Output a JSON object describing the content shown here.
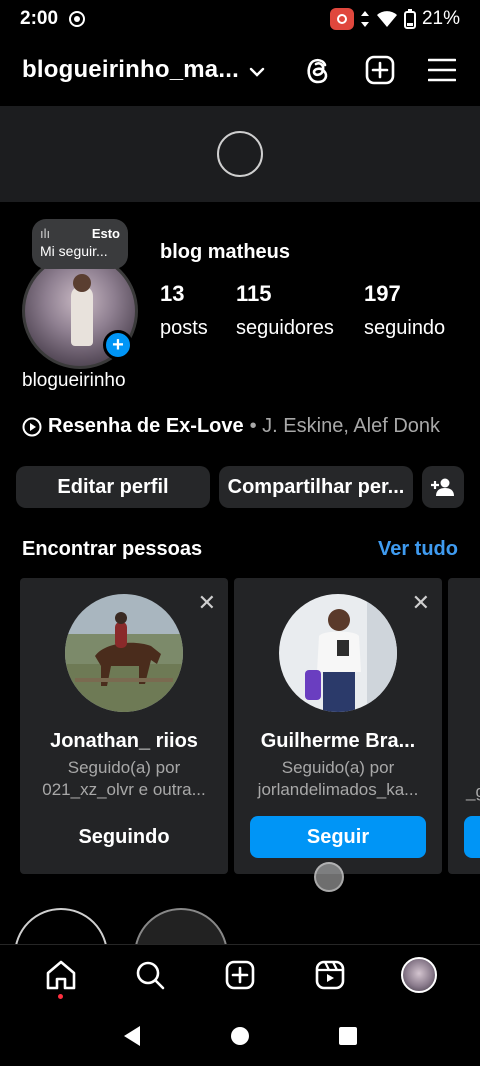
{
  "status": {
    "time": "2:00",
    "battery": "21%"
  },
  "header": {
    "username": "blogueirinho_ma..."
  },
  "profile": {
    "note_prefix": "Esto",
    "note_text": "Mi seguir...",
    "display_name": "blog matheus",
    "handle": "blogueirinho",
    "stats": [
      {
        "num": "13",
        "label": "posts"
      },
      {
        "num": "115",
        "label": "seguidores"
      },
      {
        "num": "197",
        "label": "seguindo"
      }
    ],
    "music_title": "Resenha de Ex-Love",
    "music_artists": "• J. Eskine, Alef Donk"
  },
  "actions": {
    "edit": "Editar perfil",
    "share": "Compartilhar per..."
  },
  "suggestions": {
    "heading": "Encontrar pessoas",
    "see_all": "Ver tudo",
    "cards": [
      {
        "name": "Jonathan_ riios",
        "line1": "Seguido(a) por",
        "line2": "021_xz_olvr e outra...",
        "action": "Seguindo"
      },
      {
        "name": "Guilherme Bra...",
        "line1": "Seguido(a) por",
        "line2": "jorlandelimados_ka...",
        "action": "Seguir"
      }
    ],
    "peek_text": "_g"
  },
  "icons": {
    "threads": "threads-icon",
    "add": "plus-square-icon",
    "menu": "hamburger-menu-icon",
    "home": "home-icon",
    "search": "search-icon",
    "create": "create-post-icon",
    "reels": "reels-icon",
    "profile": "profile-avatar"
  },
  "colors": {
    "accent": "#0095f6",
    "link": "#3f9bf0",
    "button_bg": "#262729",
    "card_bg": "#232426"
  }
}
